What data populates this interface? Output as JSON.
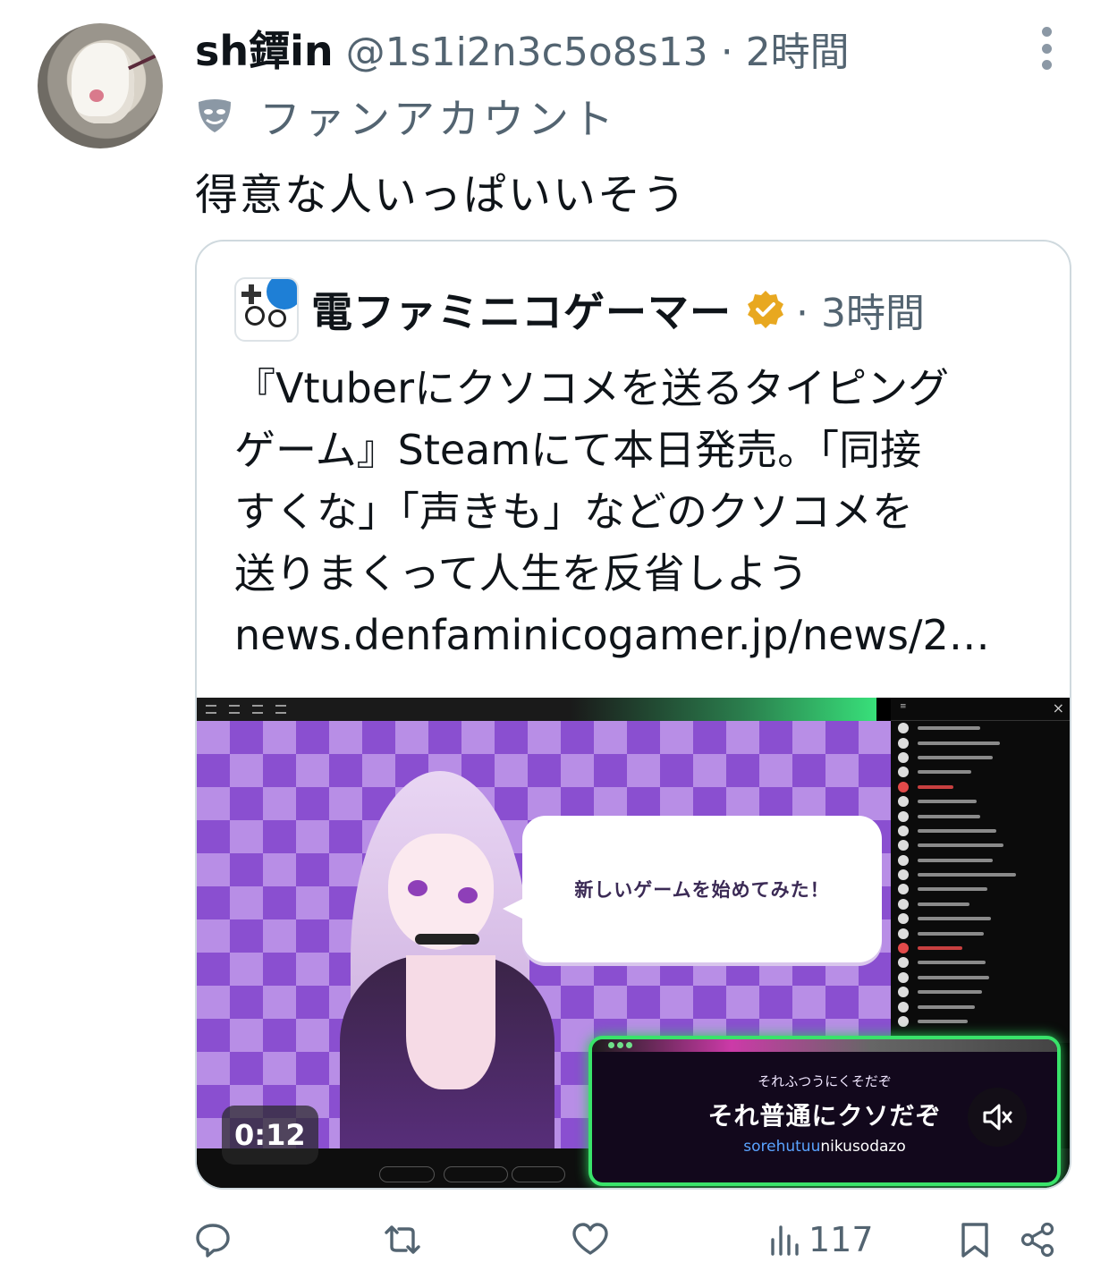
{
  "tweet": {
    "display_name": "sh鐔in",
    "handle": "@1s1i2n3c5o8s13",
    "time": "2時間",
    "separator": "·",
    "fan_label": "ファンアカウント",
    "text": "得意な人いっぱいいそう"
  },
  "quote": {
    "display_name": "電ファミニコゲーマー",
    "verified": true,
    "time": "3時間",
    "separator": "·",
    "text_lines": [
      "『Vtuberにクソコメを送るタイピング",
      "ゲーム』Steamにて本日発売。「同接",
      "すくな」「声きも」などのクソコメを",
      "送りまくって人生を反省しよう",
      "news.denfaminicogamer.jp/news/2…"
    ],
    "video": {
      "timestamp": "0:12",
      "muted": true,
      "speech_bubble": "新しいゲームを始めてみた！",
      "typing_kana": "それふつうにくそだぞ",
      "typing_main": "それ普通にクソだぞ",
      "typing_romaji_done": "sorehutuu",
      "typing_romaji_rest": "nikusodazo"
    }
  },
  "actions": {
    "reply_icon": "reply-icon",
    "retweet_icon": "retweet-icon",
    "like_icon": "heart-icon",
    "views_icon": "analytics-icon",
    "views_count": "117",
    "bookmark_icon": "bookmark-icon",
    "share_icon": "share-icon"
  },
  "colors": {
    "text_primary": "#0f1419",
    "text_secondary": "#536471",
    "card_border": "#cfd9de",
    "verified_gold": "#e8a820",
    "typing_glow": "#39e36a"
  }
}
